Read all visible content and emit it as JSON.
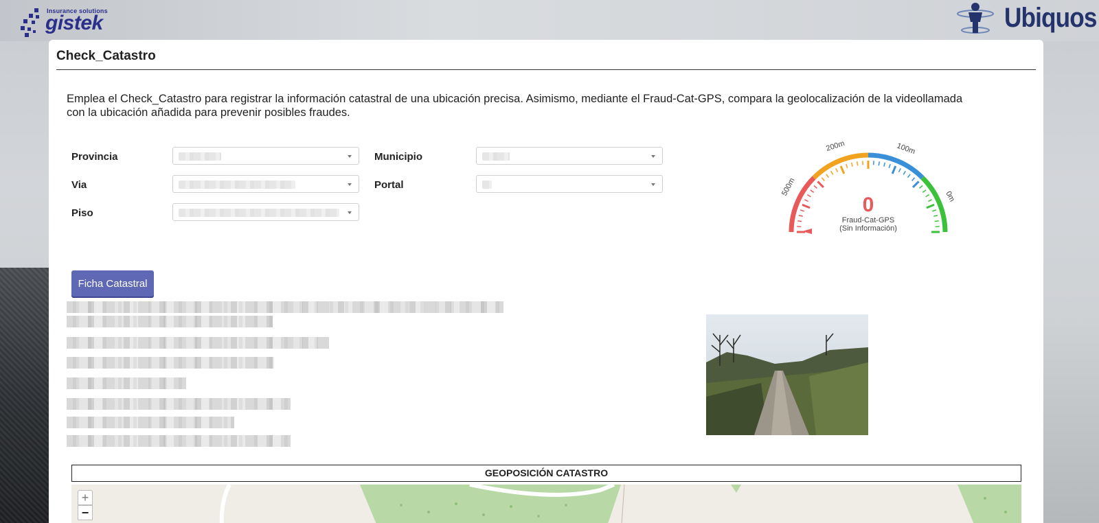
{
  "brand": {
    "left_logo_tagline": "Insurance solutions",
    "left_logo_name": "gistek",
    "right_logo_name": "Ubiquos"
  },
  "page": {
    "title": "Check_Catastro",
    "intro": "Emplea el Check_Catastro para registrar la información catastral de una ubicación precisa. Asimismo, mediante el Fraud-Cat-GPS, compara la geolocalización de la videollamada con la ubicación añadida para prevenir posibles fraudes."
  },
  "form": {
    "provincia_label": "Provincia",
    "municipio_label": "Municipio",
    "via_label": "Via",
    "portal_label": "Portal",
    "piso_label": "Piso"
  },
  "gauge": {
    "value": "0",
    "caption_line1": "Fraud-Cat-GPS",
    "caption_line2": "(Sin Información)",
    "tick_500": "500m",
    "tick_200": "200m",
    "tick_100": "100m",
    "tick_0": "0m",
    "colors": {
      "red": "#e85a5a",
      "orange": "#f1a21f",
      "blue": "#3a8fd9",
      "green": "#3cc23a"
    }
  },
  "actions": {
    "ficha_catastral": "Ficha Catastral"
  },
  "map": {
    "header": "GEOPOSICIÓN CATASTRO",
    "zoom_in": "+",
    "zoom_out": "−"
  },
  "colors": {
    "primary_button": "#5f68b5",
    "brand_blue": "#24336b"
  }
}
